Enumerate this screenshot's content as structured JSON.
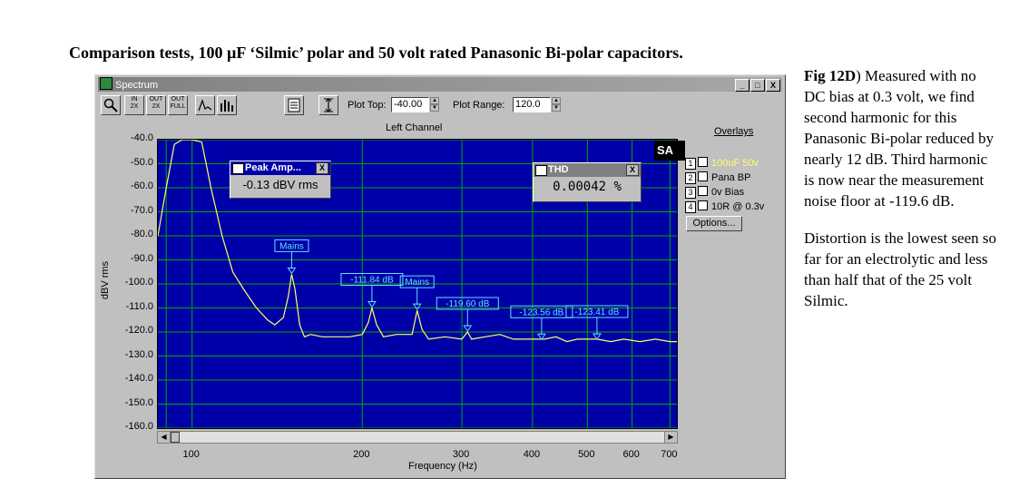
{
  "document": {
    "title": "Comparison tests, 100 µF ‘Silmic’ polar and 50 volt rated Panasonic Bi-polar capacitors.",
    "caption_lead": "Fig 12D",
    "caption_p1": ") Measured with no DC bias at 0.3  volt, we find second harmonic for this Panasonic Bi-polar reduced by nearly 12 dB. Third harmonic is now near the measurement noise floor at -119.6 dB.",
    "caption_p2": "Distortion is the lowest seen so far for an electrolytic and less than half that of the 25 volt Silmic."
  },
  "window": {
    "title": "Spectrum",
    "minimize": "_",
    "maximize": "□",
    "close": "X"
  },
  "toolbar": {
    "zoom_in": "IN\n2X",
    "zoom_out": "OUT\n2X",
    "zoom_full": "OUT\nFULL",
    "plot_top_label": "Plot Top:",
    "plot_top_value": "-40.00",
    "plot_range_label": "Plot Range:",
    "plot_range_value": "120.0"
  },
  "plot": {
    "channel": "Left Channel"
  },
  "peak_popup": {
    "title": "Peak Amp...",
    "value": "-0.13 dBV rms"
  },
  "thd_popup": {
    "title": "THD",
    "value": "0.00042 %"
  },
  "overlays": {
    "title": "Overlays",
    "items": [
      {
        "num": "1",
        "label": "100uF 50v",
        "color": "#ffff66"
      },
      {
        "num": "2",
        "label": "Pana BP",
        "color": "#000000"
      },
      {
        "num": "3",
        "label": "0v Bias",
        "color": "#000000"
      },
      {
        "num": "4",
        "label": "10R @ 0.3v",
        "color": "#000000"
      }
    ],
    "options_label": "Options..."
  },
  "logo": {
    "text": "SA"
  },
  "chart_data": {
    "type": "line",
    "title": "Left Channel",
    "xlabel": "Frequency (Hz)",
    "ylabel": "dBV rms",
    "x_scale": "log",
    "xlim": [
      87,
      720
    ],
    "ylim": [
      -160,
      -40
    ],
    "x_ticks": [
      100,
      200,
      300,
      400,
      500,
      600,
      700
    ],
    "y_ticks": [
      -40,
      -50,
      -60,
      -70,
      -80,
      -90,
      -100,
      -110,
      -120,
      -130,
      -140,
      -150,
      -160
    ],
    "y_tick_labels": [
      "-40.0",
      "-50.0",
      "-60.0",
      "-70.0",
      "-80.0",
      "-90.0",
      "-100.0",
      "-110.0",
      "-120.0",
      "-130.0",
      "-140.0",
      "-150.0",
      "-160.0"
    ],
    "grid": true,
    "series": [
      {
        "name": "100uF 50v",
        "color": "#ffff66",
        "x": [
          87,
          90,
          93,
          96,
          100,
          104,
          108,
          113,
          118,
          124,
          130,
          136,
          140,
          145,
          148,
          150,
          152,
          155,
          158,
          162,
          170,
          180,
          190,
          200,
          205,
          208,
          212,
          218,
          230,
          245,
          250,
          255,
          262,
          280,
          300,
          307,
          312,
          330,
          350,
          370,
          400,
          420,
          440,
          460,
          480,
          500,
          520,
          550,
          580,
          620,
          660,
          700,
          720
        ],
        "y": [
          -80,
          -60,
          -42,
          -40,
          -40,
          -41,
          -60,
          -80,
          -95,
          -103,
          -110,
          -115,
          -117,
          -114,
          -105,
          -96,
          -102,
          -117,
          -122,
          -121,
          -122,
          -122,
          -122,
          -121,
          -116,
          -110,
          -117,
          -122,
          -121,
          -121,
          -111,
          -119,
          -123,
          -122,
          -123,
          -120,
          -123,
          -122,
          -121,
          -123,
          -123,
          -123,
          -122,
          -124,
          -123,
          -123,
          -123,
          -124,
          -123,
          -124,
          -123,
          -124,
          -124
        ]
      }
    ],
    "annotations": [
      {
        "text": "Mains",
        "x": 150,
        "y": -96
      },
      {
        "text": "-111.84 dB",
        "x": 208,
        "y": -110
      },
      {
        "text": "Mains",
        "x": 250,
        "y": -111
      },
      {
        "text": "-119.60 dB",
        "x": 307,
        "y": -120
      },
      {
        "text": "-123.56 dB",
        "x": 415,
        "y": -123.5
      },
      {
        "text": "-123.41 dB",
        "x": 520,
        "y": -123.4
      }
    ]
  }
}
